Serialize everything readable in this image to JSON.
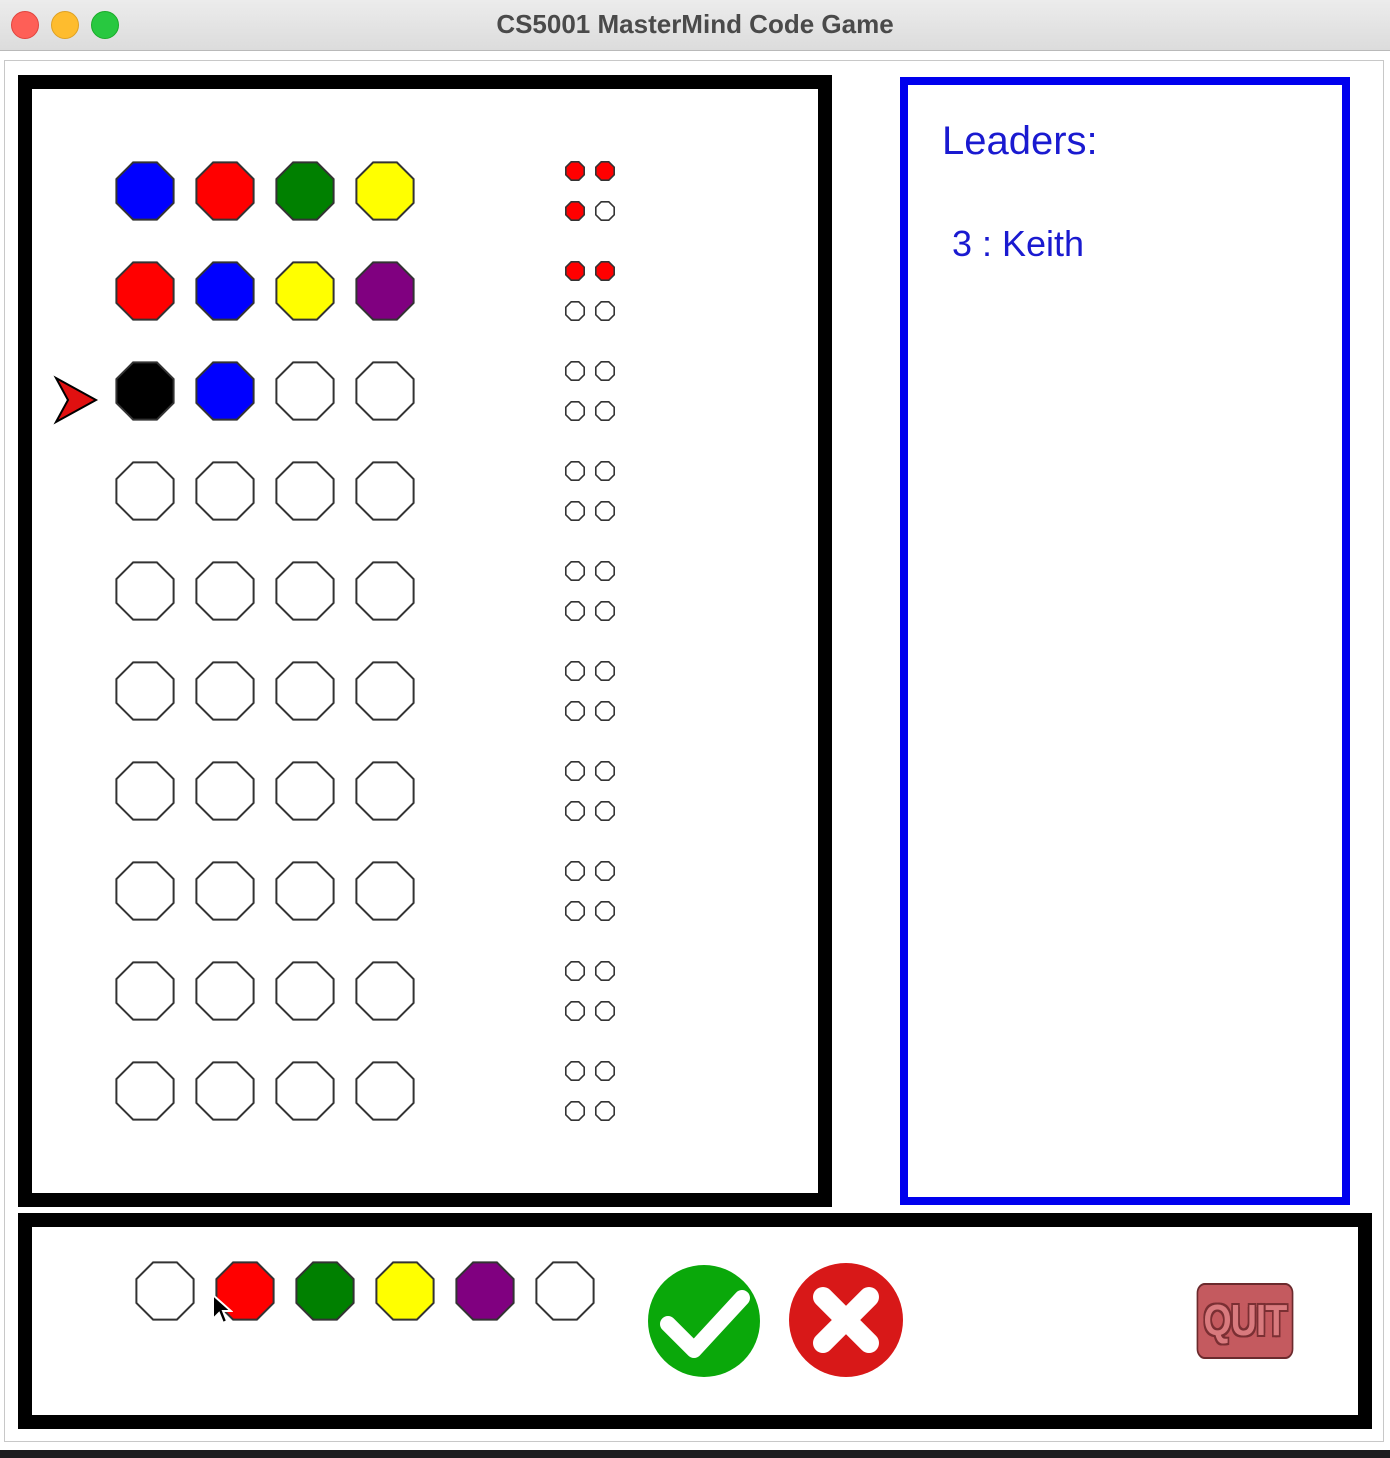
{
  "window": {
    "title": "CS5001 MasterMind Code Game"
  },
  "colors": {
    "blue": "#0000ff",
    "red": "#ff0000",
    "green": "#008000",
    "yellow": "#ffff00",
    "purple": "#800080",
    "black": "#000000",
    "white": "#ffffff",
    "leaders_text": "#1a1ad0",
    "leaders_border": "#0000ee",
    "ok_button": "#0aa80a",
    "cancel_button": "#d81818"
  },
  "board": {
    "current_row": 3,
    "guesses": [
      [
        "blue",
        "red",
        "green",
        "yellow"
      ],
      [
        "red",
        "blue",
        "yellow",
        "purple"
      ],
      [
        "black",
        "blue",
        "white",
        "white"
      ],
      [
        "white",
        "white",
        "white",
        "white"
      ],
      [
        "white",
        "white",
        "white",
        "white"
      ],
      [
        "white",
        "white",
        "white",
        "white"
      ],
      [
        "white",
        "white",
        "white",
        "white"
      ],
      [
        "white",
        "white",
        "white",
        "white"
      ],
      [
        "white",
        "white",
        "white",
        "white"
      ],
      [
        "white",
        "white",
        "white",
        "white"
      ]
    ],
    "feedback": [
      [
        "red",
        "red",
        "red",
        "white"
      ],
      [
        "red",
        "red",
        "white",
        "white"
      ],
      [
        "white",
        "white",
        "white",
        "white"
      ],
      [
        "white",
        "white",
        "white",
        "white"
      ],
      [
        "white",
        "white",
        "white",
        "white"
      ],
      [
        "white",
        "white",
        "white",
        "white"
      ],
      [
        "white",
        "white",
        "white",
        "white"
      ],
      [
        "white",
        "white",
        "white",
        "white"
      ],
      [
        "white",
        "white",
        "white",
        "white"
      ],
      [
        "white",
        "white",
        "white",
        "white"
      ]
    ]
  },
  "leaders": {
    "title": "Leaders:",
    "entries": [
      "3 : Keith"
    ]
  },
  "controls": {
    "palette": [
      "white",
      "red",
      "green",
      "yellow",
      "purple",
      "white"
    ],
    "ok_icon": "checkmark-icon",
    "cancel_icon": "x-icon",
    "quit_label": "QUIT"
  }
}
